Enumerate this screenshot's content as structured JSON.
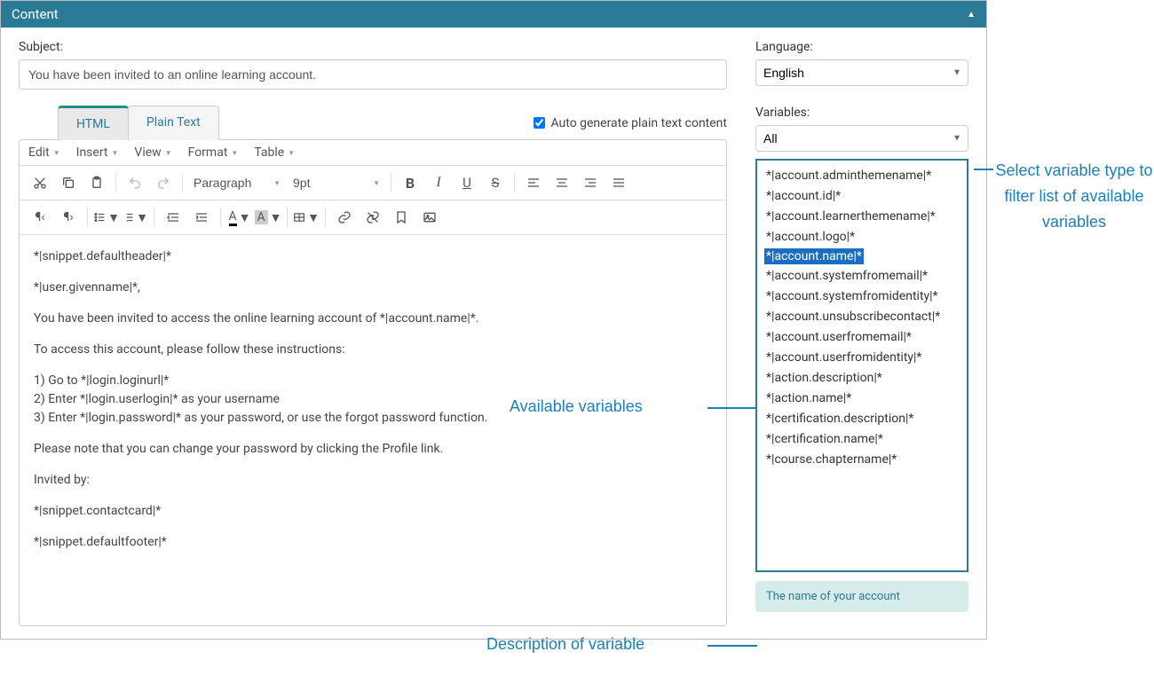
{
  "panel": {
    "title": "Content"
  },
  "subject": {
    "label": "Subject:",
    "value": "You have been invited to an online learning account."
  },
  "language": {
    "label": "Language:",
    "value": "English"
  },
  "tabs": {
    "html": "HTML",
    "plain": "Plain Text"
  },
  "auto_gen": {
    "label": "Auto generate plain text content",
    "checked": true
  },
  "menus": {
    "edit": "Edit",
    "insert": "Insert",
    "view": "View",
    "format": "Format",
    "table": "Table"
  },
  "toolbar": {
    "para": "Paragraph",
    "size": "9pt"
  },
  "content": {
    "l1": "*|snippet.defaultheader|*",
    "l2": "*|user.givenname|*,",
    "l3": "You have been invited to access the online learning account of *|account.name|*.",
    "l4": "To access this account, please follow these instructions:",
    "l5": "1) Go to *|login.loginurl|*",
    "l6": "2) Enter *|login.userlogin|* as your username",
    "l7": "3) Enter *|login.password|* as your password, or use the forgot password function.",
    "l8": "Please note that you can change your password by clicking the Profile link.",
    "l9": "Invited by:",
    "l10": "*|snippet.contactcard|*",
    "l11": "*|snippet.defaultfooter|*"
  },
  "variables": {
    "label": "Variables:",
    "filter": "All",
    "list": [
      "*|account.adminthemename|*",
      "*|account.id|*",
      "*|account.learnerthemename|*",
      "*|account.logo|*",
      "*|account.name|*",
      "*|account.systemfromemail|*",
      "*|account.systemfromidentity|*",
      "*|account.unsubscribecontact|*",
      "*|account.userfromemail|*",
      "*|account.userfromidentity|*",
      "*|action.description|*",
      "*|action.name|*",
      "*|certification.description|*",
      "*|certification.name|*",
      "*|course.chaptername|*"
    ],
    "selected_index": 4,
    "desc": "The name of your account"
  },
  "annotations": {
    "filter": "Select variable type to filter list of available variables",
    "available": "Available variables",
    "desc": "Description of variable"
  }
}
